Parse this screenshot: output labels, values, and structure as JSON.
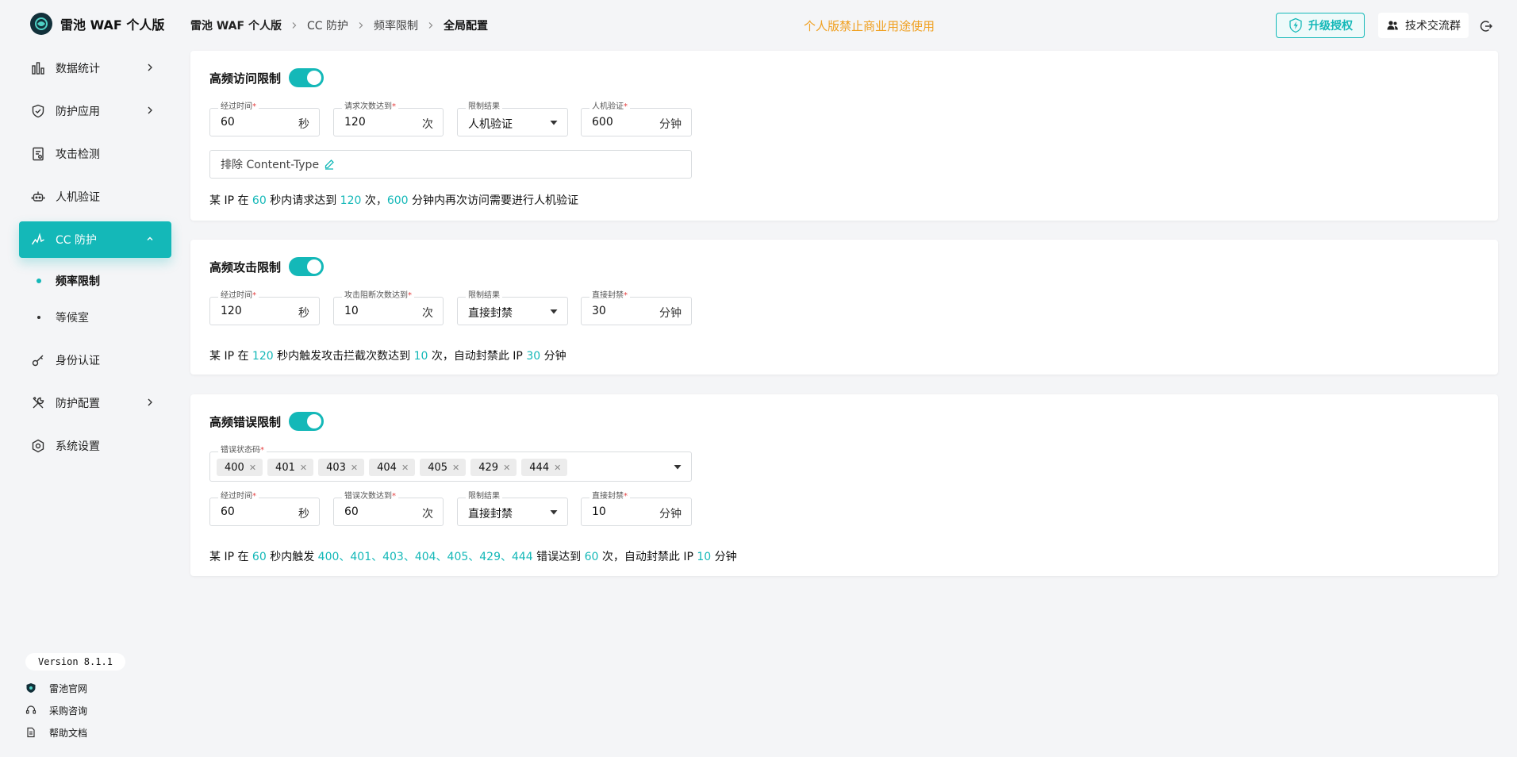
{
  "brand": {
    "name": "雷池 WAF 个人版"
  },
  "sidebar": {
    "items": [
      {
        "label": "数据统计",
        "icon": "bar-chart-icon",
        "has_children": true
      },
      {
        "label": "防护应用",
        "icon": "shield-icon",
        "has_children": true
      },
      {
        "label": "攻击检测",
        "icon": "document-check-icon",
        "has_children": false
      },
      {
        "label": "人机验证",
        "icon": "robot-icon",
        "has_children": false
      },
      {
        "label": "CC 防护",
        "icon": "pulse-icon",
        "has_children": true,
        "active": true,
        "expanded": true
      },
      {
        "label": "身份认证",
        "icon": "key-icon",
        "has_children": false
      },
      {
        "label": "防护配置",
        "icon": "tools-icon",
        "has_children": true
      },
      {
        "label": "系统设置",
        "icon": "gear-icon",
        "has_children": false
      }
    ],
    "cc_submenu": [
      {
        "label": "频率限制",
        "active": true
      },
      {
        "label": "等候室",
        "active": false
      }
    ],
    "version": "Version 8.1.1",
    "footer_links": [
      {
        "label": "雷池官网",
        "icon": "shield-logo-icon"
      },
      {
        "label": "采购咨询",
        "icon": "headset-icon"
      },
      {
        "label": "帮助文档",
        "icon": "document-icon"
      }
    ]
  },
  "header": {
    "breadcrumb": [
      "雷池 WAF 个人版",
      "CC 防护",
      "频率限制",
      "全局配置"
    ],
    "notice": "个人版禁止商业用途使用",
    "upgrade_label": "升级授权",
    "group_label": "技术交流群"
  },
  "colors": {
    "accent": "#14b8b8",
    "notice": "#f0a020",
    "required": "#e53e3e"
  },
  "access_limit": {
    "title": "高频访问限制",
    "enabled": true,
    "fields": {
      "period": {
        "label": "经过时间",
        "value": "60",
        "unit": "秒"
      },
      "count": {
        "label": "请求次数达到",
        "value": "120",
        "unit": "次"
      },
      "result": {
        "label": "限制结果",
        "value": "人机验证"
      },
      "duration": {
        "label": "人机验证",
        "value": "600",
        "unit": "分钟"
      }
    },
    "exclude_label": "排除 Content-Type",
    "desc": {
      "t1": "某 IP 在 ",
      "v1": "60",
      "t2": " 秒内请求达到 ",
      "v2": "120",
      "t3": " 次，",
      "v3": "600",
      "t4": " 分钟内再次访问需要进行人机验证"
    }
  },
  "attack_limit": {
    "title": "高频攻击限制",
    "enabled": true,
    "fields": {
      "period": {
        "label": "经过时间",
        "value": "120",
        "unit": "秒"
      },
      "count": {
        "label": "攻击阻断次数达到",
        "value": "10",
        "unit": "次"
      },
      "result": {
        "label": "限制结果",
        "value": "直接封禁"
      },
      "duration": {
        "label": "直接封禁",
        "value": "30",
        "unit": "分钟"
      }
    },
    "desc": {
      "t1": "某 IP 在 ",
      "v1": "120",
      "t2": " 秒内触发攻击拦截次数达到 ",
      "v2": "10",
      "t3": " 次，自动封禁此 IP ",
      "v3": "30",
      "t4": " 分钟"
    }
  },
  "error_limit": {
    "title": "高频错误限制",
    "enabled": true,
    "codes_label": "错误状态码",
    "codes": [
      "400",
      "401",
      "403",
      "404",
      "405",
      "429",
      "444"
    ],
    "fields": {
      "period": {
        "label": "经过时间",
        "value": "60",
        "unit": "秒"
      },
      "count": {
        "label": "错误次数达到",
        "value": "60",
        "unit": "次"
      },
      "result": {
        "label": "限制结果",
        "value": "直接封禁"
      },
      "duration": {
        "label": "直接封禁",
        "value": "10",
        "unit": "分钟"
      }
    },
    "desc": {
      "t1": "某 IP 在 ",
      "v1": "60",
      "t2": " 秒内触发 ",
      "v2": "400、401、403、404、405、429、444",
      "t3": " 错误达到 ",
      "v3": "60",
      "t4": " 次，自动封禁此 IP ",
      "v4": "10",
      "t5": " 分钟"
    }
  }
}
